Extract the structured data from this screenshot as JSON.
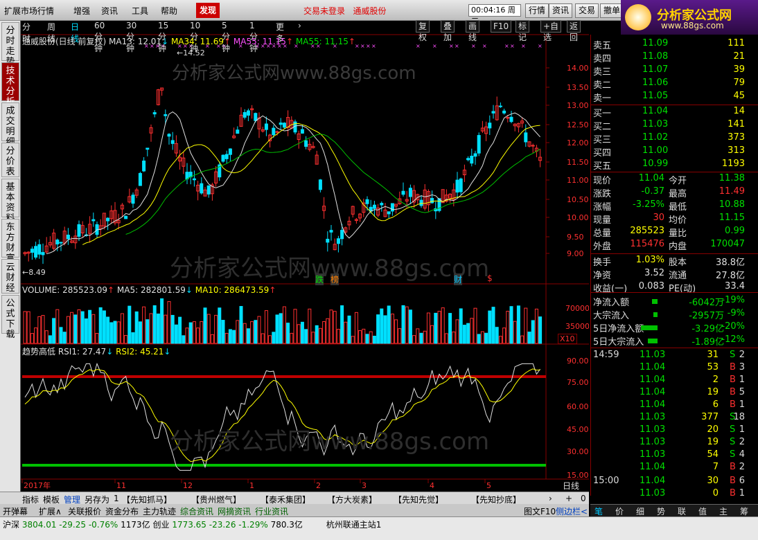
{
  "menu": [
    "扩展市场行情",
    "增强",
    "资讯",
    "工具",
    "帮助"
  ],
  "discover_label": "发现",
  "banner": [
    "交易未登录",
    "通威股份"
  ],
  "clock": "00:04:16 周三",
  "right_buttons": [
    "行情",
    "资讯",
    "交易",
    "撤单"
  ],
  "logo": {
    "text": "分析家公式网",
    "url": "www.88gs.com"
  },
  "left_tabs": [
    "分时走势",
    "技术分析",
    "成交明细",
    "分价表",
    "基本资料",
    "东方财富",
    "云财经",
    "公式下载"
  ],
  "period_tabs": [
    "分时",
    "周线",
    "日线",
    "60分钟",
    "30分钟",
    "15分钟",
    "10分钟",
    "5分钟",
    "1分钟",
    "更多",
    "›"
  ],
  "active_period": "日线",
  "chart_tools": [
    "复权",
    "叠加",
    "画线",
    "F10",
    "标记",
    "+自选",
    "返回"
  ],
  "ma_legend": {
    "title": "通威股份(日线 前复权)",
    "items": [
      {
        "label": "MA13: 12.01",
        "arrow": "↓",
        "color": "#e0e0e0"
      },
      {
        "label": "MA34: 11.69",
        "arrow": "↑",
        "color": "#ffff00"
      },
      {
        "label": "MA55: 11.15",
        "arrow": "↑",
        "color": "#ff50ff"
      },
      {
        "label": "MA55: 11.15",
        "arrow": "↑",
        "color": "#00e000"
      }
    ]
  },
  "price_axis": [
    "14.00",
    "13.50",
    "13.00",
    "12.50",
    "12.00",
    "11.50",
    "11.00",
    "10.50",
    "10.00",
    "9.50",
    "9.00"
  ],
  "high_mark": "14.52",
  "low_mark": "8.49",
  "watermark": "分析家公式网www.88gs.com",
  "events": [
    "跌",
    "榜",
    "财",
    "$"
  ],
  "volume_legend": [
    {
      "label": "VOLUME: 285523.09",
      "arrow": "↑",
      "color": "#e0e0e0"
    },
    {
      "label": "MA5: 282801.59",
      "arrow": "↓",
      "color": "#e0e0e0"
    },
    {
      "label": "MA10: 286473.59",
      "arrow": "↑",
      "color": "#ffff00"
    }
  ],
  "volume_axis": [
    "70000",
    "35000"
  ],
  "volume_unit": "X10",
  "rsi_legend": {
    "title": "趋势高低",
    "items": [
      {
        "label": "RSI1: 27.47",
        "arrow": "↓",
        "color": "#e0e0e0"
      },
      {
        "label": "RSI2: 45.21",
        "arrow": "↓",
        "color": "#ffff00"
      }
    ]
  },
  "rsi_axis": [
    "90.00",
    "75.00",
    "60.00",
    "45.00",
    "30.00",
    "15.00"
  ],
  "date_axis": [
    "2017年",
    "11",
    "12",
    "1",
    "2",
    "3",
    "4",
    "5"
  ],
  "period_label": "日线",
  "bottom_tabs": [
    "指标",
    "模板",
    "管理",
    "另存为",
    "1",
    "【先知抓马】",
    "【贵州燃气】",
    "【泰禾集团】",
    "【方大炭素】",
    "【先知先觉】",
    "【先知抄底】"
  ],
  "bottom_nav": [
    "›",
    "+",
    "0"
  ],
  "sec_tabs": [
    "开弹幕",
    "扩展∧",
    "关联报价",
    "资金分布",
    "主力轨迹",
    "综合资讯",
    "网摘资讯",
    "行业资讯"
  ],
  "sec_right": [
    "图文F10",
    "侧边栏<"
  ],
  "order_book": {
    "asks": [
      {
        "label": "卖五",
        "price": "11.09",
        "vol": "111"
      },
      {
        "label": "卖四",
        "price": "11.08",
        "vol": "21"
      },
      {
        "label": "卖三",
        "price": "11.07",
        "vol": "39"
      },
      {
        "label": "卖二",
        "price": "11.06",
        "vol": "79"
      },
      {
        "label": "卖一",
        "price": "11.05",
        "vol": "45"
      }
    ],
    "bids": [
      {
        "label": "买一",
        "price": "11.04",
        "vol": "14"
      },
      {
        "label": "买二",
        "price": "11.03",
        "vol": "141"
      },
      {
        "label": "买三",
        "price": "11.02",
        "vol": "373"
      },
      {
        "label": "买四",
        "price": "11.00",
        "vol": "313"
      },
      {
        "label": "买五",
        "price": "10.99",
        "vol": "1193"
      }
    ]
  },
  "stats": [
    {
      "l1": "现价",
      "v1": "11.04",
      "c1": "#00e000",
      "l2": "今开",
      "v2": "11.38",
      "c2": "#00e000"
    },
    {
      "l1": "涨跌",
      "v1": "-0.37",
      "c1": "#00e000",
      "l2": "最高",
      "v2": "11.49",
      "c2": "#ff3030"
    },
    {
      "l1": "涨幅",
      "v1": "-3.25%",
      "c1": "#00e000",
      "l2": "最低",
      "v2": "10.88",
      "c2": "#00e000"
    },
    {
      "l1": "现量",
      "v1": "30",
      "c1": "#ff3030",
      "l2": "均价",
      "v2": "11.15",
      "c2": "#00e000"
    },
    {
      "l1": "总量",
      "v1": "285523",
      "c1": "#ffff00",
      "l2": "量比",
      "v2": "0.99",
      "c2": "#00e000"
    },
    {
      "l1": "外盘",
      "v1": "115476",
      "c1": "#ff3030",
      "l2": "内盘",
      "v2": "170047",
      "c2": "#00e000"
    },
    {
      "l1": "换手",
      "v1": "1.03%",
      "c1": "#ffff00",
      "l2": "股本",
      "v2": "38.8亿",
      "c2": "#e0e0e0"
    },
    {
      "l1": "净资",
      "v1": "3.52",
      "c1": "#e0e0e0",
      "l2": "流通",
      "v2": "27.8亿",
      "c2": "#e0e0e0"
    },
    {
      "l1": "收益(一)",
      "v1": "0.083",
      "c1": "#e0e0e0",
      "l2": "PE(动)",
      "v2": "33.4",
      "c2": "#e0e0e0"
    }
  ],
  "flows": [
    {
      "label": "净流入额",
      "val": "-6042万",
      "pct": "-19%",
      "bar": 8
    },
    {
      "label": "大宗流入",
      "val": "-2957万",
      "pct": "-9%",
      "bar": 6
    },
    {
      "label": "5日净流入额",
      "val": "-3.29亿",
      "pct": "-20%",
      "bar": 24
    },
    {
      "label": "5日大宗流入",
      "val": "-1.89亿",
      "pct": "-12%",
      "bar": 14
    }
  ],
  "ticks": [
    {
      "time": "14:59",
      "price": "11.03",
      "vol": "31",
      "bs": "S",
      "n": "2"
    },
    {
      "time": "",
      "price": "11.04",
      "vol": "53",
      "bs": "B",
      "n": "3"
    },
    {
      "time": "",
      "price": "11.04",
      "vol": "2",
      "bs": "B",
      "n": "1"
    },
    {
      "time": "",
      "price": "11.04",
      "vol": "19",
      "bs": "B",
      "n": "5"
    },
    {
      "time": "",
      "price": "11.04",
      "vol": "6",
      "bs": "B",
      "n": "1"
    },
    {
      "time": "",
      "price": "11.03",
      "vol": "377",
      "bs": "S",
      "n": "18"
    },
    {
      "time": "",
      "price": "11.03",
      "vol": "20",
      "bs": "S",
      "n": "1"
    },
    {
      "time": "",
      "price": "11.03",
      "vol": "19",
      "bs": "S",
      "n": "2"
    },
    {
      "time": "",
      "price": "11.03",
      "vol": "54",
      "bs": "S",
      "n": "4"
    },
    {
      "time": "",
      "price": "11.04",
      "vol": "7",
      "bs": "B",
      "n": "2"
    },
    {
      "time": "15:00",
      "price": "11.04",
      "vol": "30",
      "bs": "B",
      "n": "6"
    },
    {
      "time": "",
      "price": "11.03",
      "vol": "0",
      "bs": "B",
      "n": "1"
    }
  ],
  "side_tabs": [
    "笔",
    "价",
    "细",
    "势",
    "联",
    "值",
    "主",
    "筹"
  ],
  "status": {
    "sh_label": "沪深",
    "sh_idx": "3804.01",
    "sh_chg": "-29.25",
    "sh_pct": "-0.76%",
    "sh_amt": "1173亿",
    "cy_label": "创业",
    "cy_idx": "1773.65",
    "cy_chg": "-23.26",
    "cy_pct": "-1.29%",
    "cy_amt": "780.3亿",
    "server": "杭州联通主站1"
  }
}
